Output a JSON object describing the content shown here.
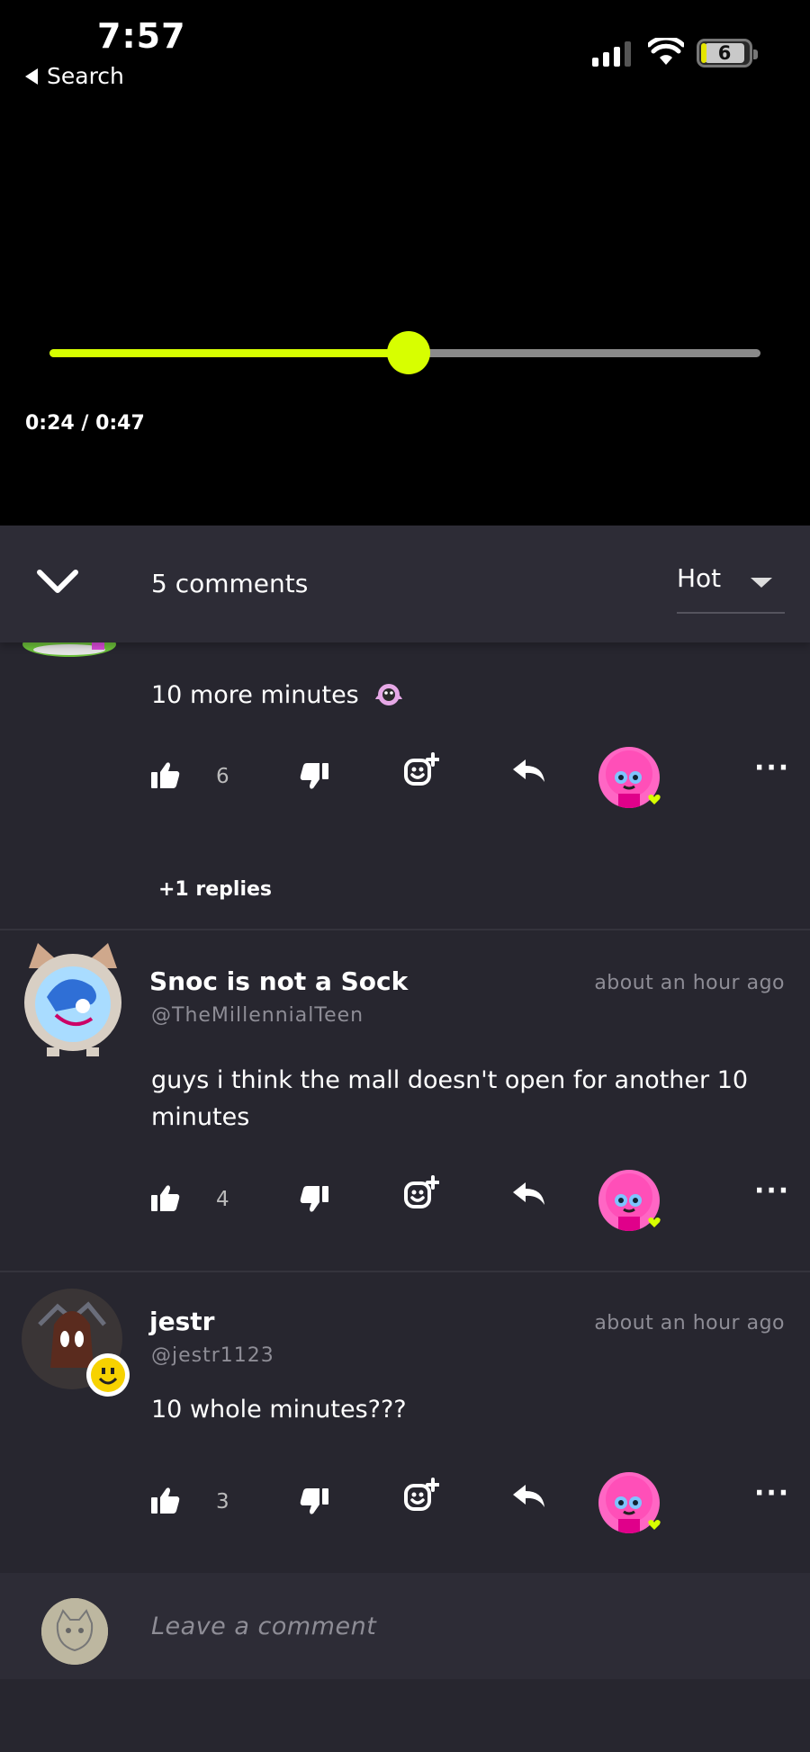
{
  "status_bar": {
    "time": "7:57",
    "back_label": "Search",
    "battery": "6"
  },
  "player": {
    "time_display": "0:24 / 0:47",
    "progress": 0.505,
    "accent_color": "#d7ff00"
  },
  "comments_panel": {
    "count_label": "5 comments",
    "sort_label": "Hot",
    "input_placeholder": "Leave a comment"
  },
  "comments": [
    {
      "text": "10 more minutes",
      "likes": "6",
      "replies_label": "+1 replies"
    },
    {
      "username": "Snoc is not a Sock",
      "handle": "@TheMillennialTeen",
      "time": "about an hour ago",
      "text": "guys i think the mall doesn't open for another 10 minutes",
      "likes": "4"
    },
    {
      "username": "jestr",
      "handle": "@jestr1123",
      "time": "about an hour ago",
      "text": "10 whole minutes???",
      "likes": "3"
    }
  ],
  "icons": {
    "like": "thumbs-up-icon",
    "dislike": "thumbs-down-icon",
    "react": "add-reaction-icon",
    "reply": "reply-icon",
    "more": "more-icon",
    "collapse": "chevron-down-icon"
  }
}
